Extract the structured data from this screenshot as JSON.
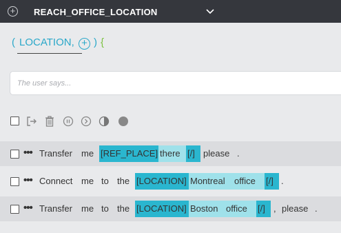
{
  "header": {
    "title": "REACH_OFFICE_LOCATION",
    "add_icon": "plus-circle-icon",
    "expand_icon": "chevron-down-icon"
  },
  "params": {
    "open_paren": "(",
    "param_name": "LOCATION,",
    "close_paren": ")",
    "brace": "{"
  },
  "user_says": {
    "placeholder": "The user says..."
  },
  "toolbar": {
    "icons": [
      "checkbox",
      "export-icon",
      "trash-icon",
      "pause-icon",
      "next-icon",
      "half-circle-icon",
      "circle-icon"
    ]
  },
  "rows": [
    {
      "tokens": [
        "Transfer",
        "me",
        "[REF_PLACE]",
        "there",
        "[/]",
        "please",
        "."
      ]
    },
    {
      "tokens": [
        "Connect",
        "me",
        "to",
        "the",
        "[LOCATION]",
        "Montreal",
        "office",
        "[/]",
        "."
      ]
    },
    {
      "tokens": [
        "Transfer",
        "me",
        "to",
        "the",
        "[LOCATION]",
        "Boston",
        "office",
        "[/]",
        ",",
        "please",
        "."
      ]
    }
  ],
  "colors": {
    "topbar": "#35373d",
    "accent": "#2aa8c9",
    "entity_tag": "#2ab6cf",
    "entity_value": "#9fe1ea",
    "brace": "#7cc242"
  }
}
